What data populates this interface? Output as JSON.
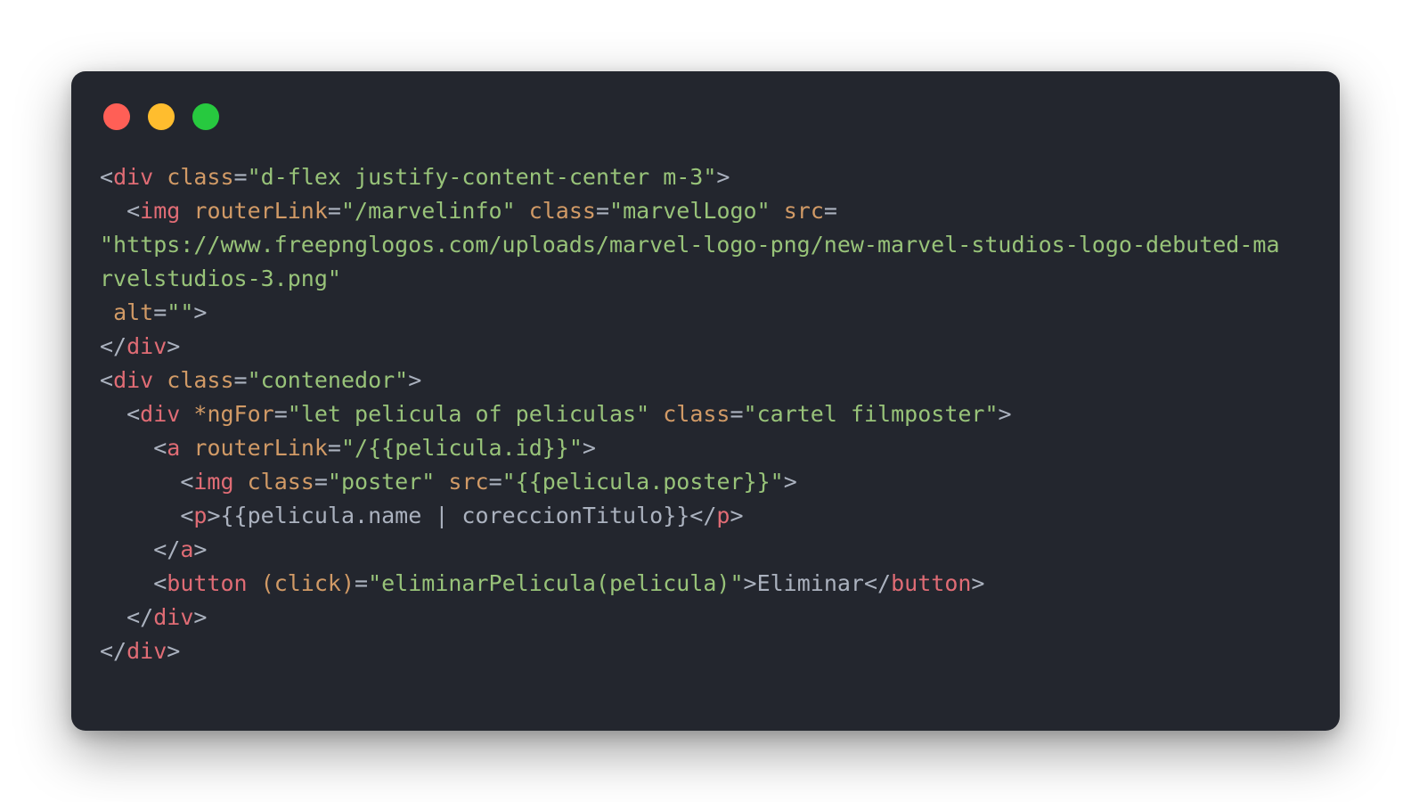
{
  "window": {
    "controls": [
      {
        "name": "close",
        "color": "#ff5f56"
      },
      {
        "name": "minimize",
        "color": "#ffbd2e"
      },
      {
        "name": "maximize",
        "color": "#27c93f"
      }
    ]
  },
  "colors": {
    "background": "#23262e",
    "punctuation": "#abb2bf",
    "tag": "#e06c75",
    "attribute": "#d19a66",
    "string": "#98c379",
    "text": "#abb2bf"
  },
  "code": {
    "lines": [
      [
        [
          "punct",
          "<"
        ],
        [
          "tag",
          "div"
        ],
        [
          "text",
          " "
        ],
        [
          "attr",
          "class"
        ],
        [
          "punct",
          "="
        ],
        [
          "str",
          "\"d-flex justify-content-center m-3\""
        ],
        [
          "punct",
          ">"
        ]
      ],
      [
        [
          "text",
          "  "
        ],
        [
          "punct",
          "<"
        ],
        [
          "tag",
          "img"
        ],
        [
          "text",
          " "
        ],
        [
          "attr",
          "routerLink"
        ],
        [
          "punct",
          "="
        ],
        [
          "str",
          "\"/marvelinfo\""
        ],
        [
          "text",
          " "
        ],
        [
          "attr",
          "class"
        ],
        [
          "punct",
          "="
        ],
        [
          "str",
          "\"marvelLogo\""
        ],
        [
          "text",
          " "
        ],
        [
          "attr",
          "src"
        ],
        [
          "punct",
          "="
        ]
      ],
      [
        [
          "str",
          "\"https://www.freepnglogos.com/uploads/marvel-logo-png/new-marvel-studios-logo-debuted-ma"
        ]
      ],
      [
        [
          "str",
          "rvelstudios-3.png\""
        ]
      ],
      [
        [
          "text",
          " "
        ],
        [
          "attr",
          "alt"
        ],
        [
          "punct",
          "="
        ],
        [
          "str",
          "\"\""
        ],
        [
          "punct",
          ">"
        ]
      ],
      [
        [
          "punct",
          "</"
        ],
        [
          "tag",
          "div"
        ],
        [
          "punct",
          ">"
        ]
      ],
      [
        [
          "punct",
          "<"
        ],
        [
          "tag",
          "div"
        ],
        [
          "text",
          " "
        ],
        [
          "attr",
          "class"
        ],
        [
          "punct",
          "="
        ],
        [
          "str",
          "\"contenedor\""
        ],
        [
          "punct",
          ">"
        ]
      ],
      [
        [
          "text",
          "  "
        ],
        [
          "punct",
          "<"
        ],
        [
          "tag",
          "div"
        ],
        [
          "text",
          " "
        ],
        [
          "attr",
          "*ngFor"
        ],
        [
          "punct",
          "="
        ],
        [
          "str",
          "\"let pelicula of peliculas\""
        ],
        [
          "text",
          " "
        ],
        [
          "attr",
          "class"
        ],
        [
          "punct",
          "="
        ],
        [
          "str",
          "\"cartel filmposter\""
        ],
        [
          "punct",
          ">"
        ]
      ],
      [
        [
          "text",
          "    "
        ],
        [
          "punct",
          "<"
        ],
        [
          "tag",
          "a"
        ],
        [
          "text",
          " "
        ],
        [
          "attr",
          "routerLink"
        ],
        [
          "punct",
          "="
        ],
        [
          "str",
          "\"/{{pelicula.id}}\""
        ],
        [
          "punct",
          ">"
        ]
      ],
      [
        [
          "text",
          "      "
        ],
        [
          "punct",
          "<"
        ],
        [
          "tag",
          "img"
        ],
        [
          "text",
          " "
        ],
        [
          "attr",
          "class"
        ],
        [
          "punct",
          "="
        ],
        [
          "str",
          "\"poster\""
        ],
        [
          "text",
          " "
        ],
        [
          "attr",
          "src"
        ],
        [
          "punct",
          "="
        ],
        [
          "str",
          "\"{{pelicula.poster}}\""
        ],
        [
          "punct",
          ">"
        ]
      ],
      [
        [
          "text",
          "      "
        ],
        [
          "punct",
          "<"
        ],
        [
          "tag",
          "p"
        ],
        [
          "punct",
          ">"
        ],
        [
          "text",
          "{{pelicula.name | coreccionTitulo}}"
        ],
        [
          "punct",
          "</"
        ],
        [
          "tag",
          "p"
        ],
        [
          "punct",
          ">"
        ]
      ],
      [
        [
          "text",
          "    "
        ],
        [
          "punct",
          "</"
        ],
        [
          "tag",
          "a"
        ],
        [
          "punct",
          ">"
        ]
      ],
      [
        [
          "text",
          "    "
        ],
        [
          "punct",
          "<"
        ],
        [
          "tag",
          "button"
        ],
        [
          "text",
          " "
        ],
        [
          "attr",
          "(click)"
        ],
        [
          "punct",
          "="
        ],
        [
          "str",
          "\"eliminarPelicula(pelicula)\""
        ],
        [
          "punct",
          ">"
        ],
        [
          "text",
          "Eliminar"
        ],
        [
          "punct",
          "</"
        ],
        [
          "tag",
          "button"
        ],
        [
          "punct",
          ">"
        ]
      ],
      [
        [
          "text",
          "  "
        ],
        [
          "punct",
          "</"
        ],
        [
          "tag",
          "div"
        ],
        [
          "punct",
          ">"
        ]
      ],
      [
        [
          "punct",
          "</"
        ],
        [
          "tag",
          "div"
        ],
        [
          "punct",
          ">"
        ]
      ]
    ]
  }
}
